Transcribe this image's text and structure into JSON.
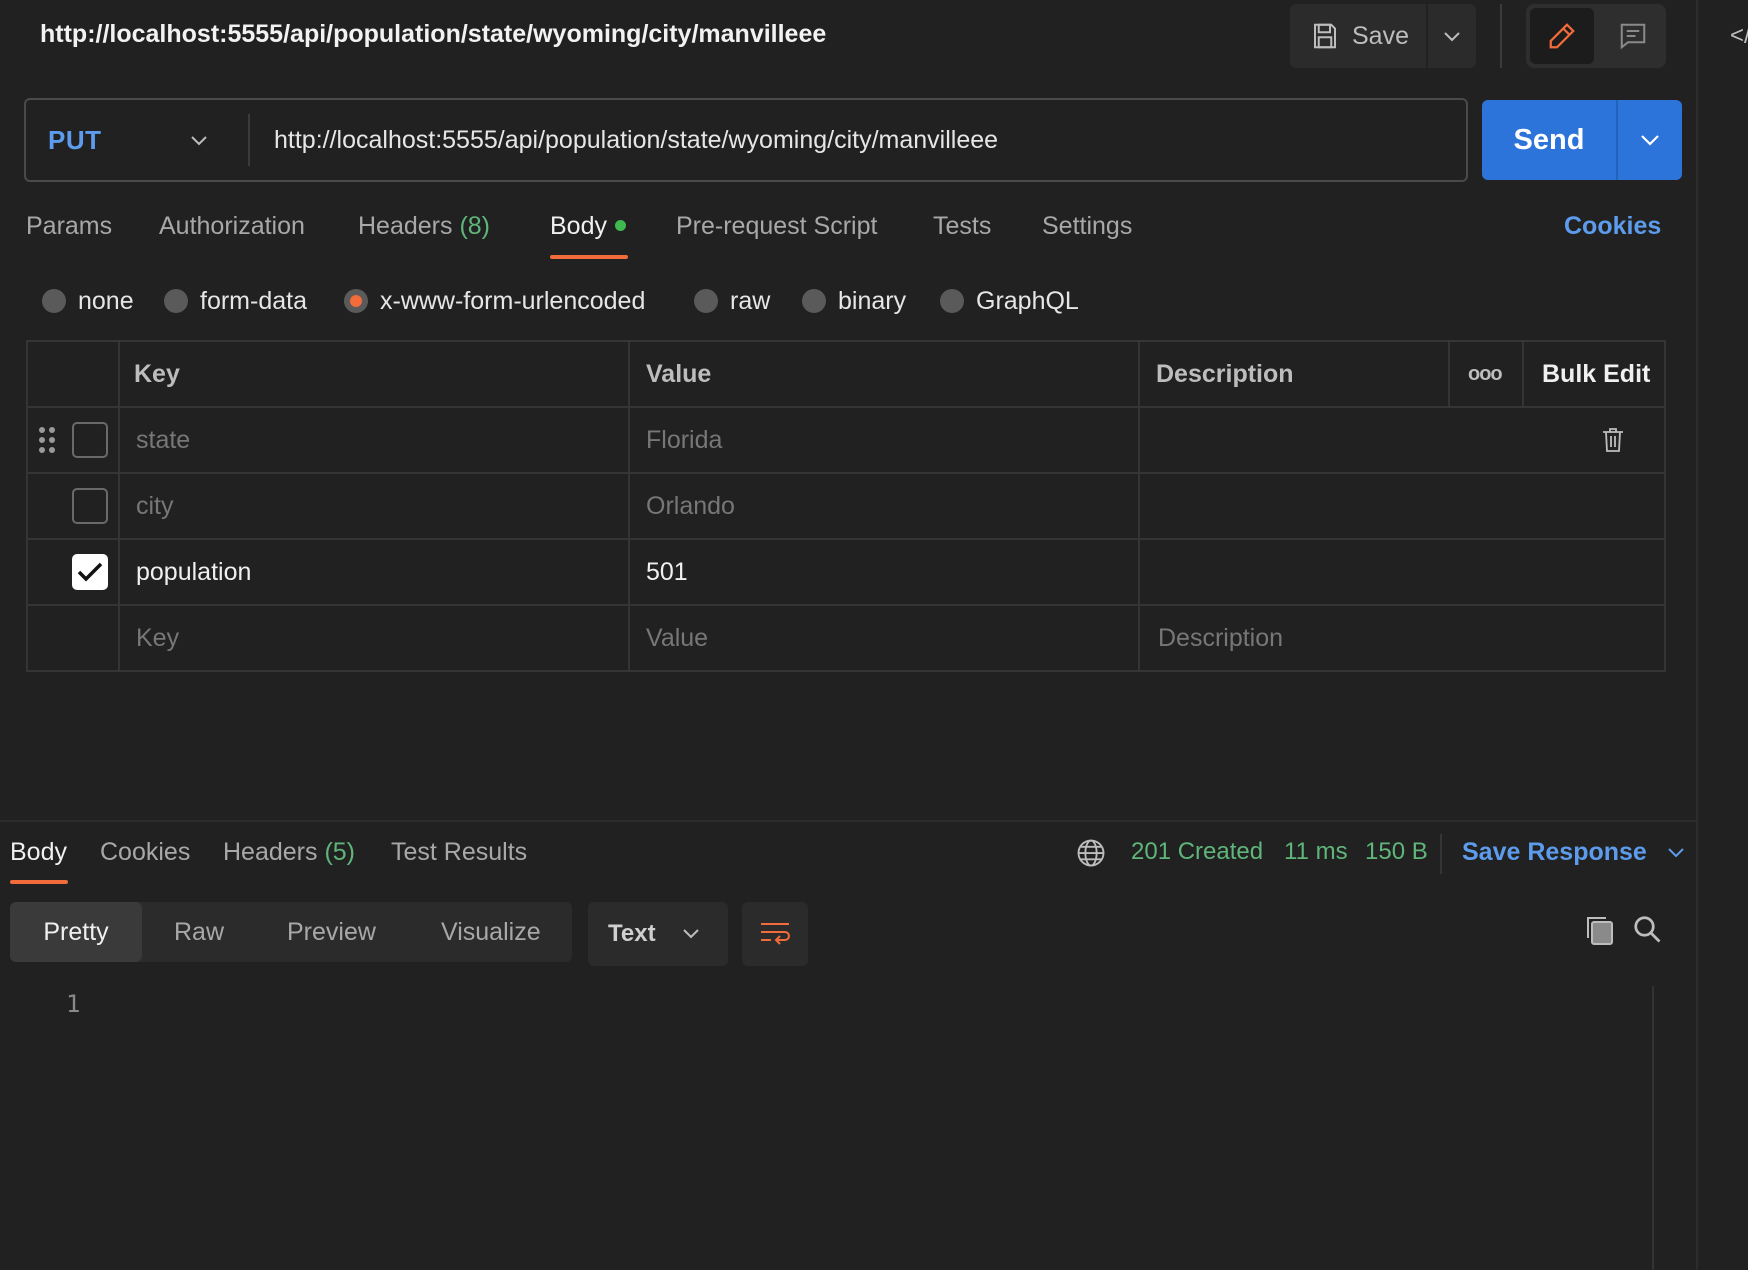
{
  "header": {
    "title_url": "http://localhost:5555/api/population/state/wyoming/city/manvilleee",
    "save_label": "Save",
    "right_panel_icon": "code-icon",
    "right_panel_text": "</"
  },
  "request": {
    "method": "PUT",
    "url": "http://localhost:5555/api/population/state/wyoming/city/manvilleee",
    "send_label": "Send"
  },
  "tabs": [
    {
      "label": "Params"
    },
    {
      "label": "Authorization"
    },
    {
      "label": "Headers",
      "count": "(8)"
    },
    {
      "label": "Body",
      "active": true
    },
    {
      "label": "Pre-request Script"
    },
    {
      "label": "Tests"
    },
    {
      "label": "Settings"
    }
  ],
  "cookies_label": "Cookies",
  "body_types": [
    {
      "label": "none",
      "selected": false
    },
    {
      "label": "form-data",
      "selected": false
    },
    {
      "label": "x-www-form-urlencoded",
      "selected": true
    },
    {
      "label": "raw",
      "selected": false
    },
    {
      "label": "binary",
      "selected": false
    },
    {
      "label": "GraphQL",
      "selected": false
    }
  ],
  "kv_table": {
    "headers": {
      "key": "Key",
      "value": "Value",
      "description": "Description",
      "more": "ooo",
      "bulk_edit": "Bulk Edit"
    },
    "rows": [
      {
        "key": "state",
        "value": "Florida",
        "description": "",
        "checked": false
      },
      {
        "key": "city",
        "value": "Orlando",
        "description": "",
        "checked": false
      },
      {
        "key": "population",
        "value": "501",
        "description": "",
        "checked": true
      }
    ],
    "placeholder": {
      "key": "Key",
      "value": "Value",
      "description": "Description"
    }
  },
  "response": {
    "tabs": [
      {
        "label": "Body",
        "active": true
      },
      {
        "label": "Cookies"
      },
      {
        "label": "Headers",
        "count": "(5)"
      },
      {
        "label": "Test Results"
      }
    ],
    "status": "201 Created",
    "time": "11 ms",
    "size": "150 B",
    "save_response_label": "Save Response",
    "views": [
      "Pretty",
      "Raw",
      "Preview",
      "Visualize"
    ],
    "format": "Text",
    "line_number": "1",
    "colors": {
      "accent": "#f26b3a",
      "success": "#5fb57a",
      "link": "#5d9cec",
      "send": "#2d74da"
    }
  }
}
